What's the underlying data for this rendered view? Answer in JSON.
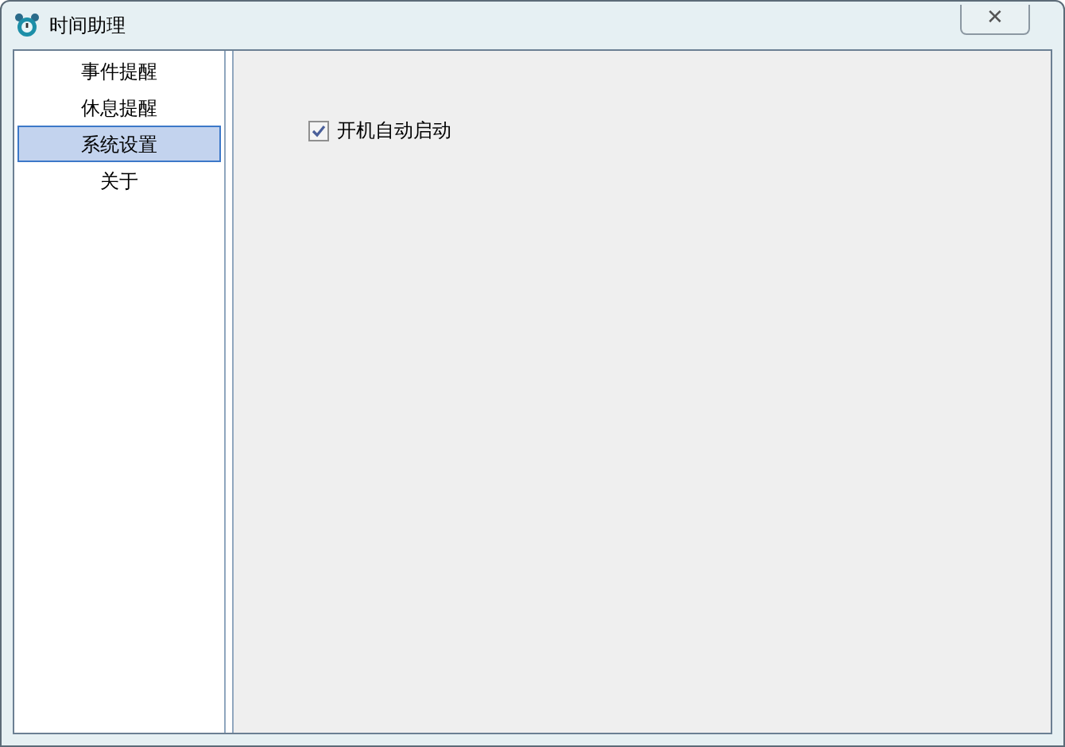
{
  "window": {
    "title": "时间助理",
    "close": "✕"
  },
  "sidebar": {
    "items": [
      {
        "label": "事件提醒",
        "selected": false
      },
      {
        "label": "休息提醒",
        "selected": false
      },
      {
        "label": "系统设置",
        "selected": true
      },
      {
        "label": "关于",
        "selected": false
      }
    ]
  },
  "settings": {
    "checkboxes": [
      {
        "label": "开机自动启动",
        "checked": true
      }
    ]
  }
}
